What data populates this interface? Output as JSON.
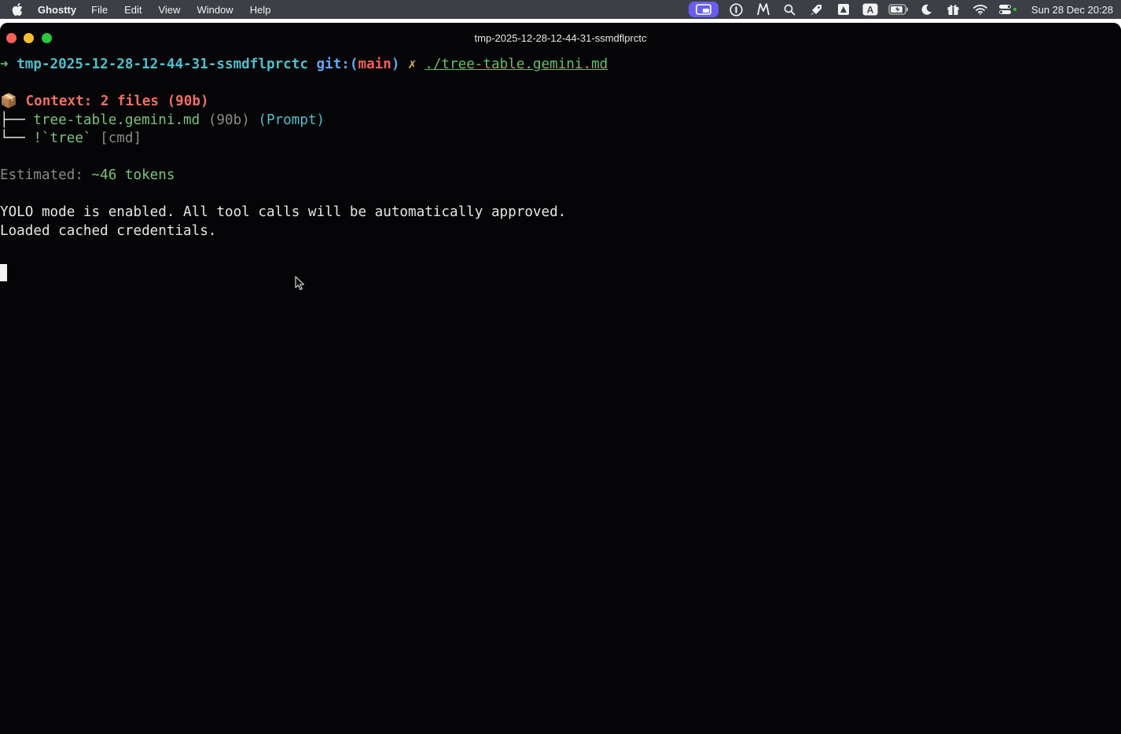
{
  "menubar": {
    "app_name": "Ghostty",
    "items": [
      "File",
      "Edit",
      "View",
      "Window",
      "Help"
    ],
    "clock": "Sun 28 Dec  20:28",
    "tray_icons": [
      "screen-share-icon",
      "1password-icon",
      "mimestream-icon",
      "spotlight-icon",
      "rocket-icon",
      "monitor-control-icon",
      "input-source-icon",
      "battery-icon",
      "focus-moon-icon",
      "gift-icon",
      "wifi-icon",
      "control-center-icon"
    ],
    "accent": "#6b5cf5",
    "input_source_label": "A"
  },
  "window": {
    "title": "tmp-2025-12-28-12-44-31-ssmdflprctc",
    "traffic_colors": {
      "close": "#fe5f57",
      "minimize": "#febc2e",
      "zoom": "#28c840"
    }
  },
  "terminal": {
    "prompt": {
      "arrow": "➜",
      "dir": "tmp-2025-12-28-12-44-31-ssmdflprctc",
      "git_prefix": "git:(",
      "branch": "main",
      "git_suffix": ")",
      "dirty_mark": "✗",
      "command": "./tree-table.gemini.md"
    },
    "context": {
      "icon": "📦",
      "label": "Context: 2 files (90b)",
      "entries": [
        {
          "branch": "├── ",
          "name": "tree-table.gemini.md",
          "size": "(90b)",
          "tag": "(Prompt)"
        },
        {
          "branch": "└── ",
          "name": "!`tree`",
          "tag": "[cmd]"
        }
      ]
    },
    "estimate": {
      "label": "Estimated: ",
      "value": "~46 tokens"
    },
    "messages": [
      "YOLO mode is enabled. All tool calls will be automatically approved.",
      "Loaded cached credentials."
    ]
  }
}
